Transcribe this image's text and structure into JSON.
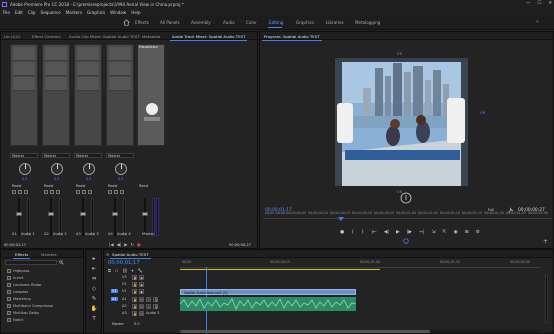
{
  "window": {
    "title": "Adobe Premiere Pro CC 2018 - E:\\premiereprojects\\1994 Aerial View in China.prproj *",
    "controls": [
      "—",
      "☐",
      "✕"
    ]
  },
  "menu": [
    "File",
    "Edit",
    "Clip",
    "Sequence",
    "Markers",
    "Graphics",
    "Window",
    "Help"
  ],
  "workspaces": {
    "tabs": [
      "Effects",
      "All Panels",
      "Assembly",
      "Audio",
      "Color",
      "Editing",
      "Graphics",
      "Libraries",
      "Metalogging"
    ],
    "active": "Editing",
    "more": "»"
  },
  "mixer_panel": {
    "tabs": [
      "Lib (0,0)",
      "Effect Controls",
      "Audio Clip Mixer: Spatial Audio TEST",
      "Metadata",
      "Audio Track Mixer: Spatial Audio TEST"
    ],
    "active_tab": "Audio Track Mixer: Spatial Audio TEST",
    "effect_slot_label": "Dissolution",
    "tracks": [
      {
        "output": "Master",
        "mode": "Read",
        "pan": "0.0",
        "vol": "0.0",
        "id": "A1",
        "name": "Audio 1"
      },
      {
        "output": "Master",
        "mode": "Read",
        "pan": "0.0",
        "vol": "0.0",
        "id": "A2",
        "name": "Audio 2"
      },
      {
        "output": "Master",
        "mode": "Read",
        "pan": "0.0",
        "vol": "0.0",
        "id": "A3",
        "name": "Audio 3"
      },
      {
        "output": "Master",
        "mode": "Read",
        "pan": "0.0",
        "vol": "0.0",
        "id": "A4",
        "name": "Audio 4"
      },
      {
        "output": "",
        "mode": "Read",
        "pan": "",
        "vol": "0.0",
        "id": "",
        "name": "Master"
      }
    ],
    "timecode_left": "00;00;01;17",
    "timecode_right": "00;00;00;27"
  },
  "program_monitor": {
    "tab": "Program: Spatial Audio TEST",
    "vr_top": "VR",
    "vr_right": "VR",
    "vr_bottom": "VR",
    "timecode_current": "00;00;01;17",
    "fit": "Full",
    "timecode_duration": "00;00;00;27",
    "ruler": [
      "00;00;00;00",
      "00;00;00;05",
      "00;00;00;10",
      "00;00;00;15",
      "00;00;00;20",
      "00;00;00;25",
      "00;00;01;00",
      "00;00;01;05",
      "00;00;01;10",
      "00;00;01;15",
      "00;00;01;20",
      "00;00;01;25",
      "00;00;02;00"
    ],
    "transport": [
      "●",
      "{",
      "}",
      "|←",
      "◀|",
      "▶",
      "|▶",
      "→|",
      "⇲",
      "⇱",
      "◉",
      "⊞",
      "⚙"
    ]
  },
  "effects_panel": {
    "tabs": [
      "Effects",
      "Markers"
    ],
    "search_value": "",
    "items": [
      "Highpass",
      "Invert",
      "Loudness Radar",
      "Lowpass",
      "Mastering",
      "Multiband Compressor",
      "Multitap Delay",
      "Notch"
    ]
  },
  "tools": [
    "▸",
    "⇤",
    "⇔",
    "◇",
    "✎",
    "✋",
    "T"
  ],
  "timeline": {
    "tab": "Spatial Audio TEST",
    "timecode": "00;00;01;17",
    "ruler": [
      "00;00",
      "00;00;00;15",
      "00;00;01;00",
      "00;00;01;15",
      "00;00;02;00"
    ],
    "tracks": [
      {
        "id": "V3",
        "name": ""
      },
      {
        "id": "V2",
        "name": ""
      },
      {
        "id": "V1",
        "name": ""
      },
      {
        "id": "A1",
        "name": ""
      },
      {
        "id": "A2",
        "name": ""
      },
      {
        "id": "A3",
        "name": "Audio 3"
      },
      {
        "id": "Master",
        "name": "0.0"
      }
    ],
    "clip_label": "Spatial Audio test.mp4 [V]",
    "colors": {
      "video_clip": "#6a8fc9",
      "audio_clip": "#3aa37a",
      "accent": "#3b82f6"
    }
  }
}
